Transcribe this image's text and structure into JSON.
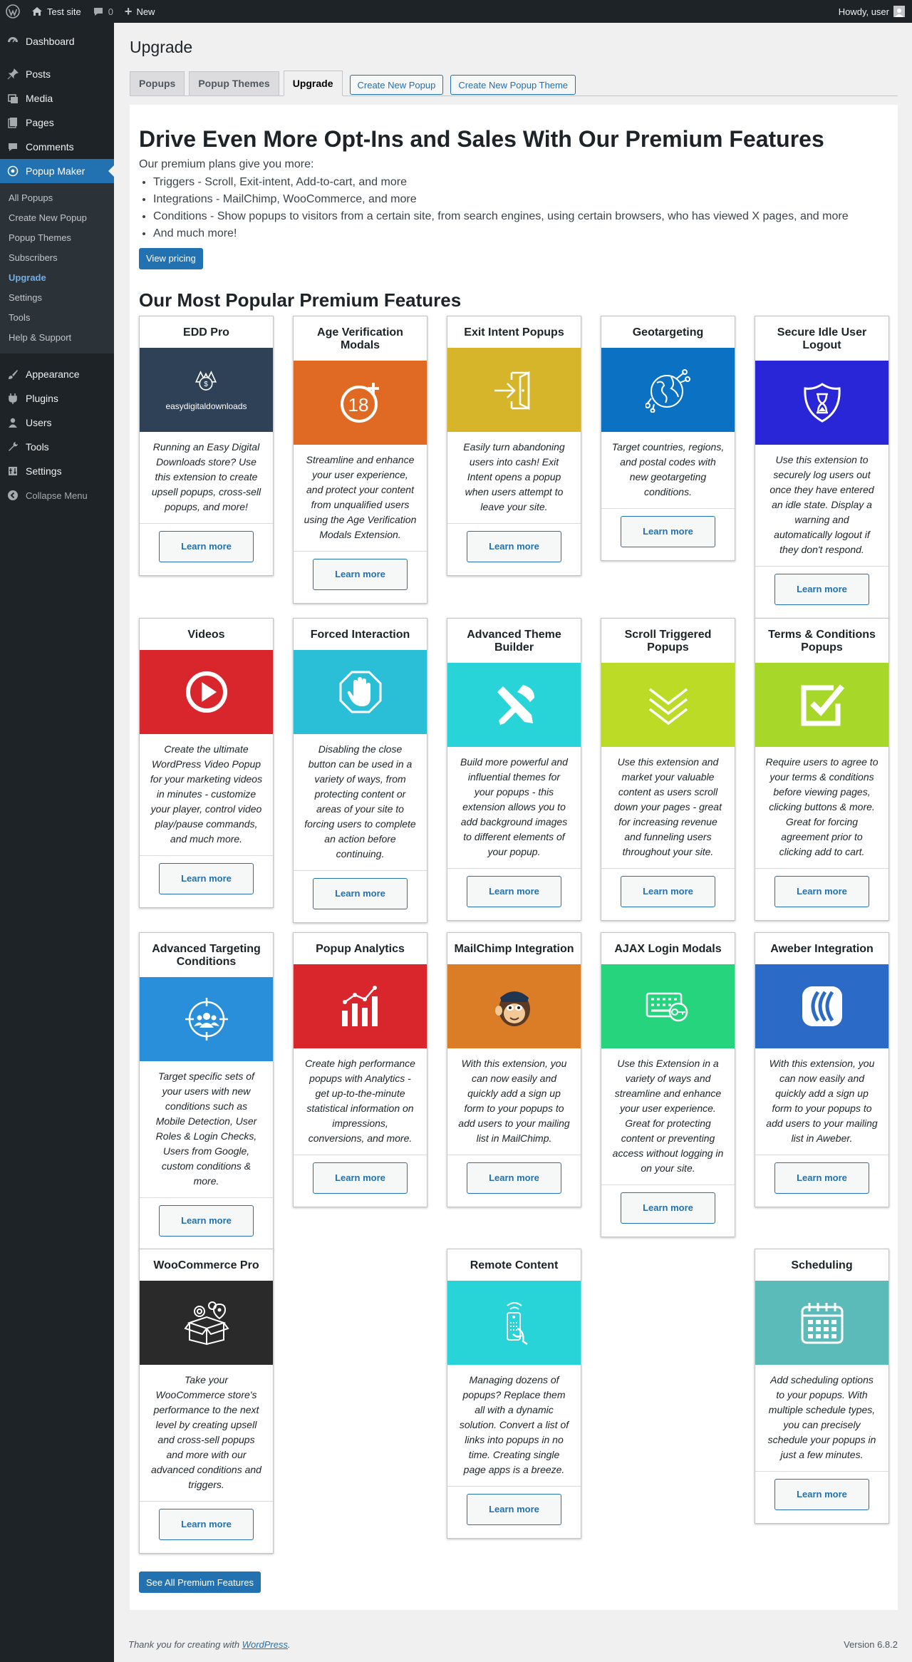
{
  "adminbar": {
    "site": "Test site",
    "comments": "0",
    "new": "New",
    "howdy": "Howdy, user"
  },
  "sidebar": {
    "top": [
      {
        "label": "Dashboard",
        "icon": "dashboard-icon"
      }
    ],
    "group1": [
      {
        "label": "Posts",
        "icon": "pushpin-icon"
      },
      {
        "label": "Media",
        "icon": "media-icon"
      },
      {
        "label": "Pages",
        "icon": "pages-icon"
      },
      {
        "label": "Comments",
        "icon": "comments-icon"
      }
    ],
    "current": {
      "label": "Popup Maker",
      "icon": "popup-maker-icon"
    },
    "submenu": [
      "All Popups",
      "Create New Popup",
      "Popup Themes",
      "Subscribers",
      "Upgrade",
      "Settings",
      "Tools",
      "Help & Support"
    ],
    "group2": [
      {
        "label": "Appearance",
        "icon": "appearance-icon"
      },
      {
        "label": "Plugins",
        "icon": "plugins-icon"
      },
      {
        "label": "Users",
        "icon": "users-icon"
      },
      {
        "label": "Tools",
        "icon": "tools-icon"
      },
      {
        "label": "Settings",
        "icon": "settings-icon"
      }
    ],
    "collapse": "Collapse Menu"
  },
  "page": {
    "title": "Upgrade"
  },
  "tabs": [
    "Popups",
    "Popup Themes",
    "Upgrade"
  ],
  "tab_buttons": [
    "Create New Popup",
    "Create New Popup Theme"
  ],
  "hero": {
    "heading": "Drive Even More Opt-Ins and Sales With Our Premium Features",
    "intro": "Our premium plans give you more:",
    "benefits": [
      "Triggers - Scroll, Exit-intent, Add-to-cart, and more",
      "Integrations - MailChimp, WooCommerce, and more",
      "Conditions - Show popups to visitors from a certain site, from search engines, using certain browsers, who has viewed X pages, and more",
      "And much more!"
    ],
    "cta": "View pricing"
  },
  "features_heading": "Our Most Popular Premium Features",
  "features": [
    {
      "title": "EDD Pro",
      "color": "#2f4157",
      "icon": "edd-logo-icon",
      "logo_text": "easydigitaldownloads",
      "desc": "Running an Easy Digital Downloads store? Use this extension to create upsell popups, cross-sell popups, and more!",
      "btn": "Learn more"
    },
    {
      "title": "Age Verification Modals",
      "color": "#e06a23",
      "icon": "age-18-plus-icon",
      "desc": "Streamline and enhance your user experience, and protect your content from unqualified users using the Age Verification Modals Extension.",
      "btn": "Learn more"
    },
    {
      "title": "Exit Intent Popups",
      "color": "#d6b52a",
      "icon": "exit-door-icon",
      "desc": "Easily turn abandoning users into cash! Exit Intent opens a popup when users attempt to leave your site.",
      "btn": "Learn more"
    },
    {
      "title": "Geotargeting",
      "color": "#0b71c2",
      "icon": "globe-network-icon",
      "desc": "Target countries, regions, and postal codes with new geotargeting conditions.",
      "btn": "Learn more"
    },
    {
      "title": "Secure Idle User Logout",
      "color": "#2926d8",
      "icon": "shield-hourglass-icon",
      "desc": "Use this extension to securely log users out once they have entered an idle state. Display a warning and automatically logout if they don't respond.",
      "btn": "Learn more"
    },
    {
      "title": "Videos",
      "color": "#d8262c",
      "icon": "play-button-icon",
      "desc": "Create the ultimate WordPress Video Popup for your marketing videos in minutes - customize your player, control video play/pause commands, and much more.",
      "btn": "Learn more"
    },
    {
      "title": "Forced Interaction",
      "color": "#2abfd7",
      "icon": "stop-hand-icon",
      "desc": "Disabling the close button can be used in a variety of ways, from protecting content or areas of your site to forcing users to complete an action before continuing.",
      "btn": "Learn more"
    },
    {
      "title": "Advanced Theme Builder",
      "color": "#28d4d8",
      "icon": "tools-brush-icon",
      "desc": "Build more powerful and influential themes for your popups - this extension allows you to add background images to different elements of your popup.",
      "btn": "Learn more"
    },
    {
      "title": "Scroll Triggered Popups",
      "color": "#bcdb27",
      "icon": "chevrons-down-icon",
      "desc": "Use this extension and market your valuable content as users scroll down your pages - great for increasing revenue and funneling users throughout your site.",
      "btn": "Learn more"
    },
    {
      "title": "Terms & Conditions Popups",
      "color": "#a7d829",
      "icon": "checkbox-icon",
      "desc": "Require users to agree to your terms & conditions before viewing pages, clicking buttons & more. Great for forcing agreement prior to clicking add to cart.",
      "btn": "Learn more"
    },
    {
      "title": "Advanced Targeting Conditions",
      "color": "#2a8fdb",
      "icon": "target-users-icon",
      "desc": "Target specific sets of your users with new conditions such as Mobile Detection, User Roles & Login Checks, Users from Google, custom conditions & more.",
      "btn": "Learn more"
    },
    {
      "title": "Popup Analytics",
      "color": "#d8262c",
      "icon": "bar-chart-icon",
      "desc": "Create high performance popups with Analytics - get up-to-the-minute statistical information on impressions, conversions, and more.",
      "btn": "Learn more"
    },
    {
      "title": "MailChimp Integration",
      "color": "#db7d26",
      "icon": "mailchimp-icon",
      "desc": "With this extension, you can now easily and quickly add a sign up form to your popups to add users to your mailing list in MailChimp.",
      "btn": "Learn more"
    },
    {
      "title": "AJAX Login Modals",
      "color": "#27d47e",
      "icon": "keyboard-key-icon",
      "desc": "Use this Extension in a variety of ways and streamline and enhance your user experience. Great for protecting content or preventing access without logging in on your site.",
      "btn": "Learn more"
    },
    {
      "title": "Aweber Integration",
      "color": "#2b6ac6",
      "icon": "aweber-icon",
      "desc": "With this extension, you can now easily and quickly add a sign up form to your popups to add users to your mailing list in Aweber.",
      "btn": "Learn more"
    },
    {
      "title": "WooCommerce Pro",
      "color": "#2a2a2a",
      "icon": "box-gears-icon",
      "desc": "Take your WooCommerce store's performance to the next level by creating upsell and cross-sell popups and more with our advanced conditions and triggers.",
      "btn": "Learn more"
    },
    {
      "title": "Remote Content",
      "color": "#28d4d8",
      "icon": "remote-hand-icon",
      "desc": "Managing dozens of popups? Replace them all with a dynamic solution. Convert a list of links into popups in no time. Creating single page apps is a breeze.",
      "btn": "Learn more"
    },
    {
      "title": "Scheduling",
      "color": "#5abbb8",
      "icon": "calendar-icon",
      "desc": "Add scheduling options to your popups. With multiple schedule types, you can precisely schedule your popups in just a few minutes.",
      "btn": "Learn more"
    }
  ],
  "see_all": "See All Premium Features",
  "footer": {
    "thanks_prefix": "Thank you for creating with ",
    "wp_link": "WordPress",
    "thanks_suffix": ".",
    "version": "Version 6.8.2"
  }
}
